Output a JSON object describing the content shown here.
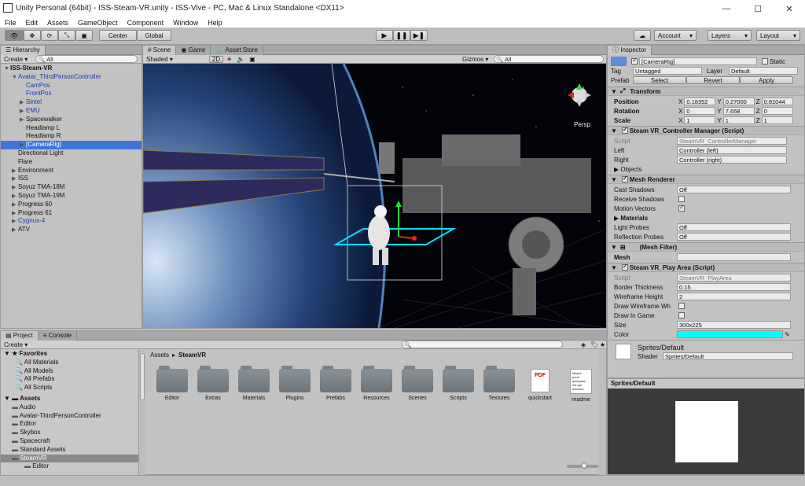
{
  "window": {
    "title": "Unity Personal (64bit) - ISS-Steam-VR.unity - ISS-Vive - PC, Mac & Linux Standalone <DX11>",
    "min": "—",
    "max": "☐",
    "close": "✕"
  },
  "menu": [
    "File",
    "Edit",
    "Assets",
    "GameObject",
    "Component",
    "Window",
    "Help"
  ],
  "toolbar": {
    "center": "Center",
    "global": "Global",
    "account": "Account",
    "layers": "Layers",
    "layout": "Layout"
  },
  "hierarchy": {
    "tab": "Hierarchy",
    "create": "Create",
    "search": "All",
    "items": [
      {
        "label": "ISS-Steam-VR",
        "indent": 0,
        "arrow": "▼",
        "style": "bold"
      },
      {
        "label": "Avatar_ThirdPersonController",
        "indent": 1,
        "arrow": "▼",
        "style": "blue"
      },
      {
        "label": "CamPos",
        "indent": 2,
        "arrow": "",
        "style": "blue"
      },
      {
        "label": "FrontPos",
        "indent": 2,
        "arrow": "",
        "style": "blue"
      },
      {
        "label": "Sintel",
        "indent": 2,
        "arrow": "▶",
        "style": "blue"
      },
      {
        "label": "EMU",
        "indent": 2,
        "arrow": "▶",
        "style": "blue"
      },
      {
        "label": "Spacewalker",
        "indent": 2,
        "arrow": "▶",
        "style": ""
      },
      {
        "label": "Headlamp L",
        "indent": 2,
        "arrow": "",
        "style": ""
      },
      {
        "label": "Headlamp R",
        "indent": 2,
        "arrow": "",
        "style": ""
      },
      {
        "label": "[CameraRig]",
        "indent": 2,
        "arrow": "▶",
        "style": "sel"
      },
      {
        "label": "Directional Light",
        "indent": 1,
        "arrow": "",
        "style": ""
      },
      {
        "label": "Flare",
        "indent": 1,
        "arrow": "",
        "style": ""
      },
      {
        "label": "Environment",
        "indent": 1,
        "arrow": "▶",
        "style": ""
      },
      {
        "label": "ISS",
        "indent": 1,
        "arrow": "▶",
        "style": ""
      },
      {
        "label": "Soyuz TMA-18M",
        "indent": 1,
        "arrow": "▶",
        "style": ""
      },
      {
        "label": "Soyuz TMA-19M",
        "indent": 1,
        "arrow": "▶",
        "style": ""
      },
      {
        "label": "Progress 60",
        "indent": 1,
        "arrow": "▶",
        "style": ""
      },
      {
        "label": "Progress 61",
        "indent": 1,
        "arrow": "▶",
        "style": ""
      },
      {
        "label": "Cygnus-4",
        "indent": 1,
        "arrow": "▶",
        "style": "blue"
      },
      {
        "label": "ATV",
        "indent": 1,
        "arrow": "▶",
        "style": ""
      }
    ]
  },
  "scene": {
    "tabs": [
      "Scene",
      "Game",
      "Asset Store"
    ],
    "shaded": "Shaded",
    "mode2d": "2D",
    "gizmos": "Gizmos",
    "search": "All",
    "persp": "Persp"
  },
  "project": {
    "tabs": [
      "Project",
      "Console"
    ],
    "create": "Create",
    "favorites_title": "Favorites",
    "favorites": [
      "All Materials",
      "All Models",
      "All Prefabs",
      "All Scripts"
    ],
    "assets_title": "Assets",
    "tree": [
      "Audio",
      "Avatar-ThirdPersonController",
      "Editor",
      "Skybox",
      "Spacecraft",
      "Standard Assets",
      "SteamVR",
      "Editor"
    ],
    "breadcrumb_root": "Assets",
    "breadcrumb_sep": "▸",
    "breadcrumb_current": "SteamVR",
    "files": [
      {
        "name": "Editor",
        "kind": "folder"
      },
      {
        "name": "Extras",
        "kind": "folder"
      },
      {
        "name": "Materials",
        "kind": "folder"
      },
      {
        "name": "Plugins",
        "kind": "folder"
      },
      {
        "name": "Prefabs",
        "kind": "folder"
      },
      {
        "name": "Resources",
        "kind": "folder"
      },
      {
        "name": "Scenes",
        "kind": "folder"
      },
      {
        "name": "Scripts",
        "kind": "folder"
      },
      {
        "name": "Textures",
        "kind": "folder"
      },
      {
        "name": "quickstart",
        "kind": "pdf"
      },
      {
        "name": "readme",
        "kind": "doc"
      }
    ],
    "readme_preview": "Neque porro quisquam est qui dolorem."
  },
  "inspector": {
    "tab": "Inspector",
    "object": "[CameraRig]",
    "static": "Static",
    "tag_label": "Tag",
    "tag": "Untagged",
    "layer_label": "Layer",
    "layer": "Default",
    "prefab_label": "Prefab",
    "select": "Select",
    "revert": "Revert",
    "apply": "Apply",
    "transform": {
      "title": "Transform",
      "rows": [
        {
          "label": "Position",
          "x": "0.18352",
          "y": "0.27000",
          "z": "0.81044"
        },
        {
          "label": "Rotation",
          "x": "0",
          "y": "7.658",
          "z": "0"
        },
        {
          "label": "Scale",
          "x": "1",
          "y": "1",
          "z": "1"
        }
      ]
    },
    "controller_manager": {
      "title": "Steam VR_Controller Manager (Script)",
      "script_label": "Script",
      "script": "SteamVR_ControllerManager",
      "left_label": "Left",
      "left": "Controller (left)",
      "right_label": "Right",
      "right": "Controller (right)",
      "objects": "Objects"
    },
    "mesh_renderer": {
      "title": "Mesh Renderer",
      "rows": [
        {
          "label": "Cast Shadows",
          "value": "Off",
          "type": "dropdown"
        },
        {
          "label": "Receive Shadows",
          "value": "",
          "type": "checkbox-off"
        },
        {
          "label": "Motion Vectors",
          "value": "",
          "type": "checkbox-on"
        }
      ],
      "materials": "Materials",
      "light_probes_label": "Light Probes",
      "light_probes": "Off",
      "reflection_probes_label": "Reflection Probes",
      "reflection_probes": "Off"
    },
    "mesh_filter": {
      "title": "(Mesh Filter)",
      "mesh_label": "Mesh"
    },
    "play_area": {
      "title": "Steam VR_Play Area (Script)",
      "script_label": "Script",
      "script": "SteamVR_PlayArea",
      "border_label": "Border Thickness",
      "border": "0.15",
      "wire_label": "Wireframe Height",
      "wire": "2",
      "draw_wire_label": "Draw Wireframe Wh",
      "draw_game_label": "Draw In Game",
      "size_label": "Size",
      "size": "300x225",
      "color_label": "Color",
      "color": "#00ffff"
    },
    "material": {
      "name": "Sprites/Default",
      "shader_label": "Shader",
      "shader": "Sprites/Default"
    },
    "preview_title": "Sprites/Default"
  }
}
